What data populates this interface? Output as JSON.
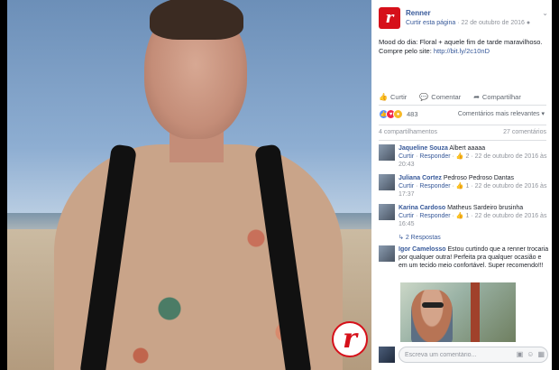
{
  "post": {
    "page_name": "Renner",
    "like_page": "Curtir esta página",
    "timestamp": "22 de outubro de 2016",
    "text": "Mood do dia: Floral + aquele fim de tarde maravilhoso. Compre pelo site: ",
    "link": "http://bit.ly/2c10nD",
    "logo_letter": "r"
  },
  "actions": {
    "like": "Curtir",
    "comment": "Comentar",
    "share": "Compartilhar"
  },
  "reactions": {
    "count": "483",
    "relevance": "Comentários mais relevantes ▾"
  },
  "counts": {
    "shares": "4 compartilhamentos",
    "comments": "27 comentários"
  },
  "comments": [
    {
      "author": "Jaqueline Souza",
      "text": "Albert aaaaa",
      "like": "Curtir",
      "reply": "Responder",
      "reactions": "2",
      "date": "22 de outubro de 2016 às 20:43"
    },
    {
      "author": "Juliana Cortez",
      "text": "Pedroso Pedroso Dantas",
      "like": "Curtir",
      "reply": "Responder",
      "reactions": "1",
      "date": "22 de outubro de 2016 às 17:37"
    },
    {
      "author": "Karina Cardoso",
      "text": "Matheus Sardeiro brusinha",
      "like": "Curtir",
      "reply": "Responder",
      "reactions": "1",
      "date": "22 de outubro de 2016 às 16:45"
    },
    {
      "author": "Igor Camelosso",
      "text": "Estou curtindo que a renner trocaria por qualquer outra! Perfeita pra qualquer ocasião e em um tecido meio confortável. Super recomendo!!!"
    }
  ],
  "replies_label": "2 Respostas",
  "input": {
    "placeholder": "Escreva um comentário..."
  },
  "colors": {
    "brand": "#d6101a",
    "link": "#365899"
  }
}
